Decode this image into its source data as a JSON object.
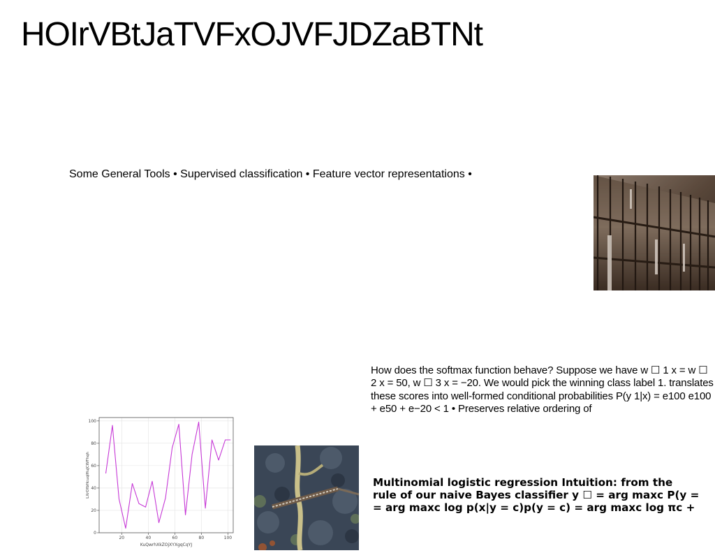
{
  "page": {
    "title": "HOIrVBtJaTVFxOJVFJDZaBTNt"
  },
  "tools_line": "Some General Tools • Supervised classification • Feature vector representations •",
  "softmax_paragraph": "How does the softmax function behave? Suppose we have w ☐ 1 x = w ☐ 2 x = 50, w ☐ 3 x = −20. We would pick the winning class label 1. translates these scores into well-formed conditional probabilities P(y 1|x) = e100 e100 + e50 + e−20 < 1 • Preserves relative ordering of",
  "mlr_paragraph": {
    "line1": "Multinomial logistic regression Intuition: from the",
    "line2": "rule of our naive Bayes classifier y ☐ = arg maxc P(y =",
    "line3": "= arg maxc log p(x|y = c)p(y = c) = arg maxc log πc +"
  },
  "images": {
    "building": "building-photo",
    "aerial": "aerial-photo"
  },
  "chart_data": {
    "type": "line",
    "title": "",
    "xlabel": "KuQwrhXkZOjXYXgqCqYJ",
    "ylabel": "LXrOfbHcuqlHuJCWFhqh",
    "x": [
      8,
      13,
      18,
      23,
      28,
      33,
      38,
      43,
      48,
      53,
      58,
      63,
      68,
      73,
      78,
      83,
      88,
      93,
      98,
      102
    ],
    "values": [
      53,
      96,
      30,
      4,
      44,
      26,
      23,
      46,
      9,
      31,
      76,
      97,
      16,
      70,
      99,
      22,
      83,
      65,
      83,
      83
    ],
    "xlim": [
      3,
      104
    ],
    "ylim": [
      0,
      103
    ],
    "xticks": [
      20,
      40,
      60,
      80,
      100
    ],
    "yticks": [
      0,
      20,
      40,
      60,
      80,
      100
    ],
    "grid": true,
    "line_color": "#c638d6"
  }
}
